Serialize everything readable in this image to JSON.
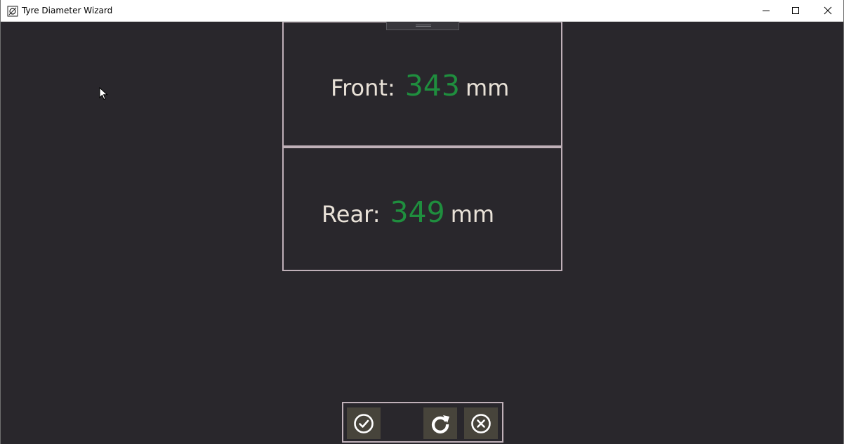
{
  "window": {
    "title": "Tyre Diameter Wizard",
    "icons": {
      "app": "app-icon",
      "minimize": "minimize-icon",
      "maximize": "maximize-icon",
      "close": "close-icon"
    }
  },
  "front": {
    "label": "Front:",
    "value": "343",
    "unit": "mm"
  },
  "rear": {
    "label": "Rear:",
    "value": "349",
    "unit": "mm"
  },
  "actions": {
    "accept_icon": "check-circle-icon",
    "retry_icon": "refresh-icon",
    "cancel_icon": "x-circle-icon"
  },
  "colors": {
    "background": "#29272c",
    "panel_border": "#bfb0b8",
    "label_text": "#e9e2d8",
    "value_text": "#1f8e3e",
    "button_bg": "#47443b"
  }
}
